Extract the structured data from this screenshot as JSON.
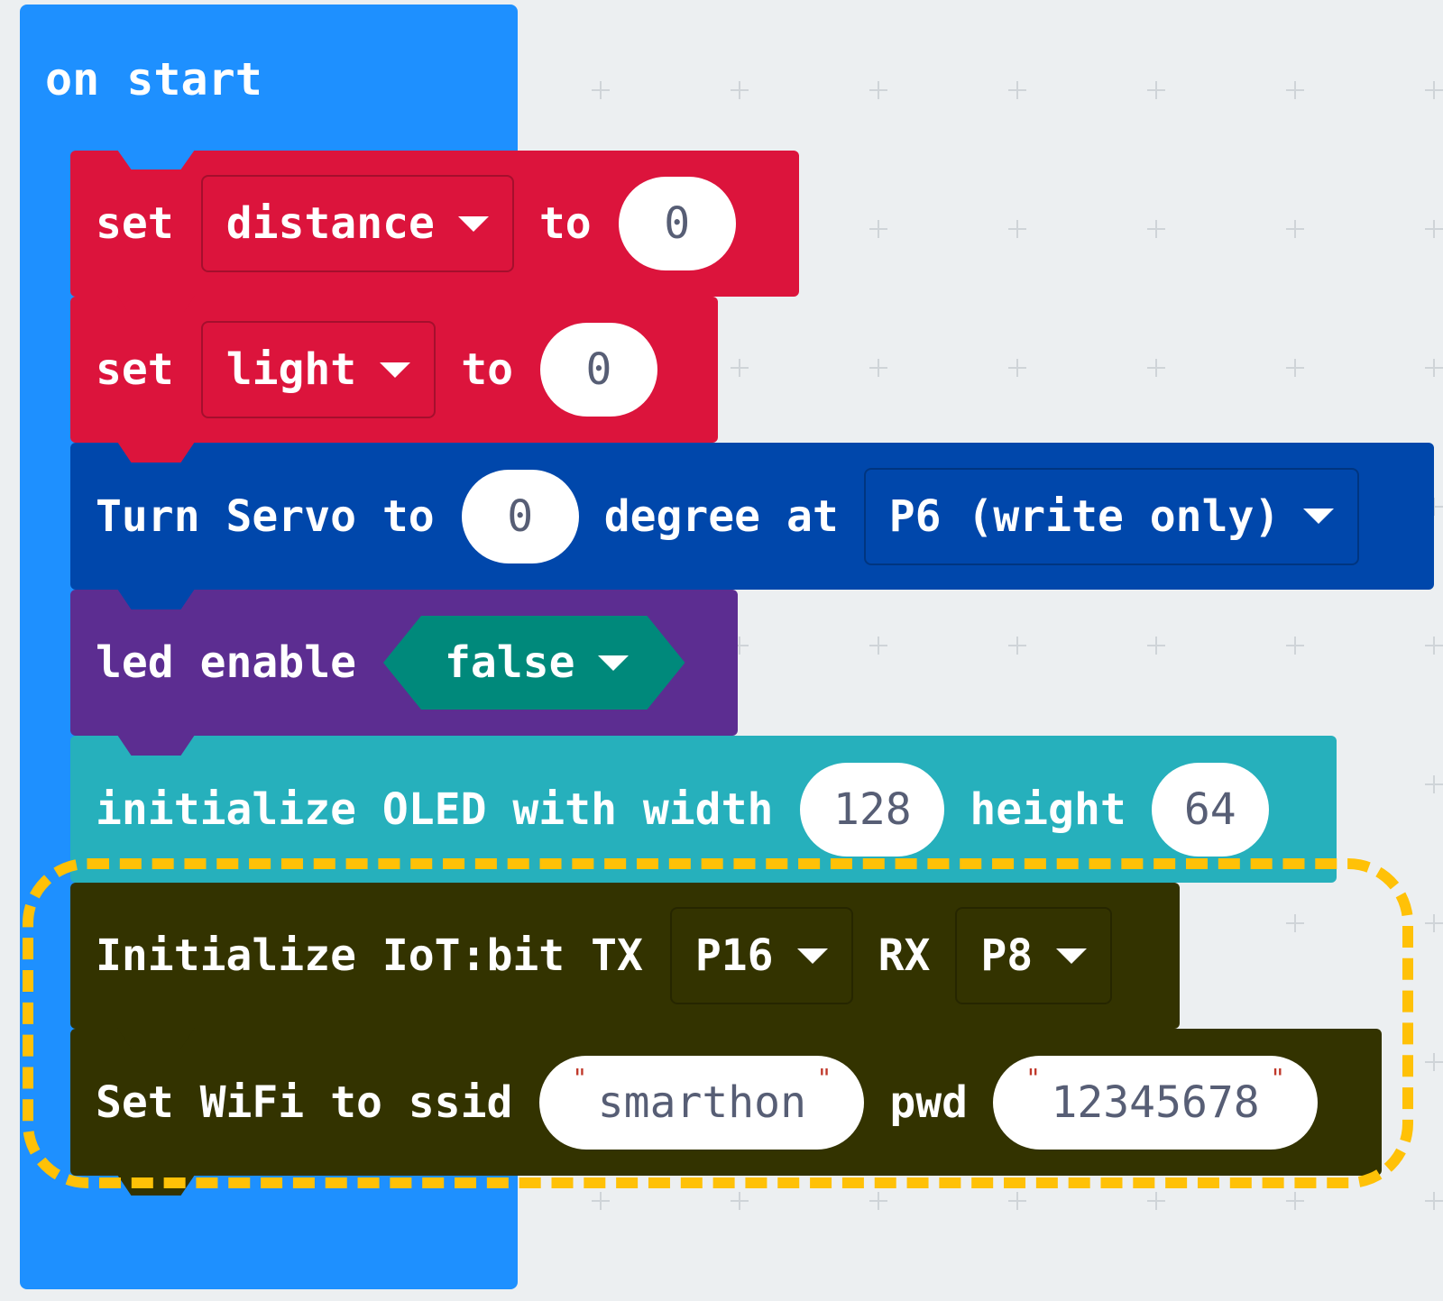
{
  "hat": {
    "label": "on start"
  },
  "blocks": {
    "set_distance": {
      "set": "set",
      "var": "distance",
      "to": "to",
      "value": "0"
    },
    "set_light": {
      "set": "set",
      "var": "light",
      "to": "to",
      "value": "0"
    },
    "servo": {
      "prefix": "Turn Servo to",
      "value": "0",
      "mid": "degree at",
      "pin": "P6 (write only)"
    },
    "led": {
      "label": "led enable",
      "value": "false"
    },
    "oled": {
      "prefix": "initialize OLED with width",
      "width": "128",
      "mid": "height",
      "height": "64"
    },
    "iot": {
      "prefix": "Initialize IoT:bit TX",
      "tx": "P16",
      "mid": "RX",
      "rx": "P8"
    },
    "wifi": {
      "prefix": "Set WiFi to ssid",
      "ssid": "smarthon",
      "mid": "pwd",
      "pwd": "12345678"
    }
  },
  "colors": {
    "hat": "#1e90ff",
    "variables": "#dc143c",
    "servo": "#0047ab",
    "led": "#5c2d91",
    "oled": "#26b0bc",
    "iot": "#333300",
    "boolean": "#00897b",
    "highlight": "#ffc107"
  },
  "icons": {
    "dropdown": "caret-down-icon"
  }
}
